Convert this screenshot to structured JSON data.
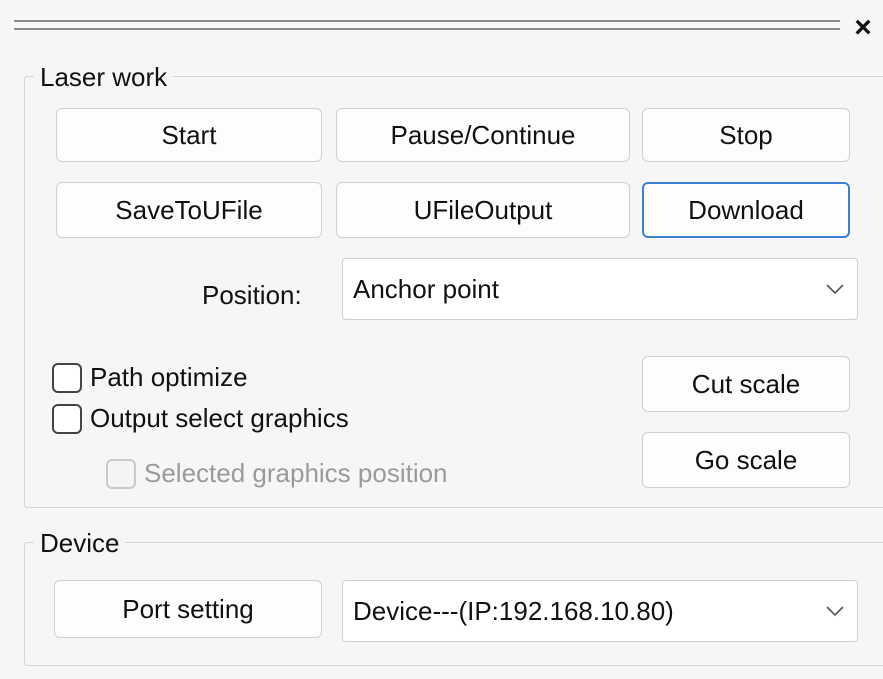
{
  "panel": {
    "close_glyph": "×"
  },
  "laser_work": {
    "legend": "Laser work",
    "buttons": {
      "start": "Start",
      "pause_continue": "Pause/Continue",
      "stop": "Stop",
      "save_to_ufile": "SaveToUFile",
      "ufile_output": "UFileOutput",
      "download": "Download",
      "cut_scale": "Cut scale",
      "go_scale": "Go scale"
    },
    "position": {
      "label": "Position:",
      "value": "Anchor point"
    },
    "checkboxes": {
      "path_optimize": {
        "label": "Path optimize",
        "checked": false
      },
      "output_select_graphics": {
        "label": "Output select graphics",
        "checked": false
      },
      "selected_graphics_position": {
        "label": "Selected graphics position",
        "checked": false,
        "disabled": true
      }
    }
  },
  "device": {
    "legend": "Device",
    "port_setting": "Port setting",
    "selected": "Device---(IP:192.168.10.80)"
  },
  "colors": {
    "accent_focus": "#3c7fd6",
    "background": "#f6f6f6"
  },
  "icons": {
    "close": "close-icon",
    "dropdown": "chevron-down-icon"
  }
}
